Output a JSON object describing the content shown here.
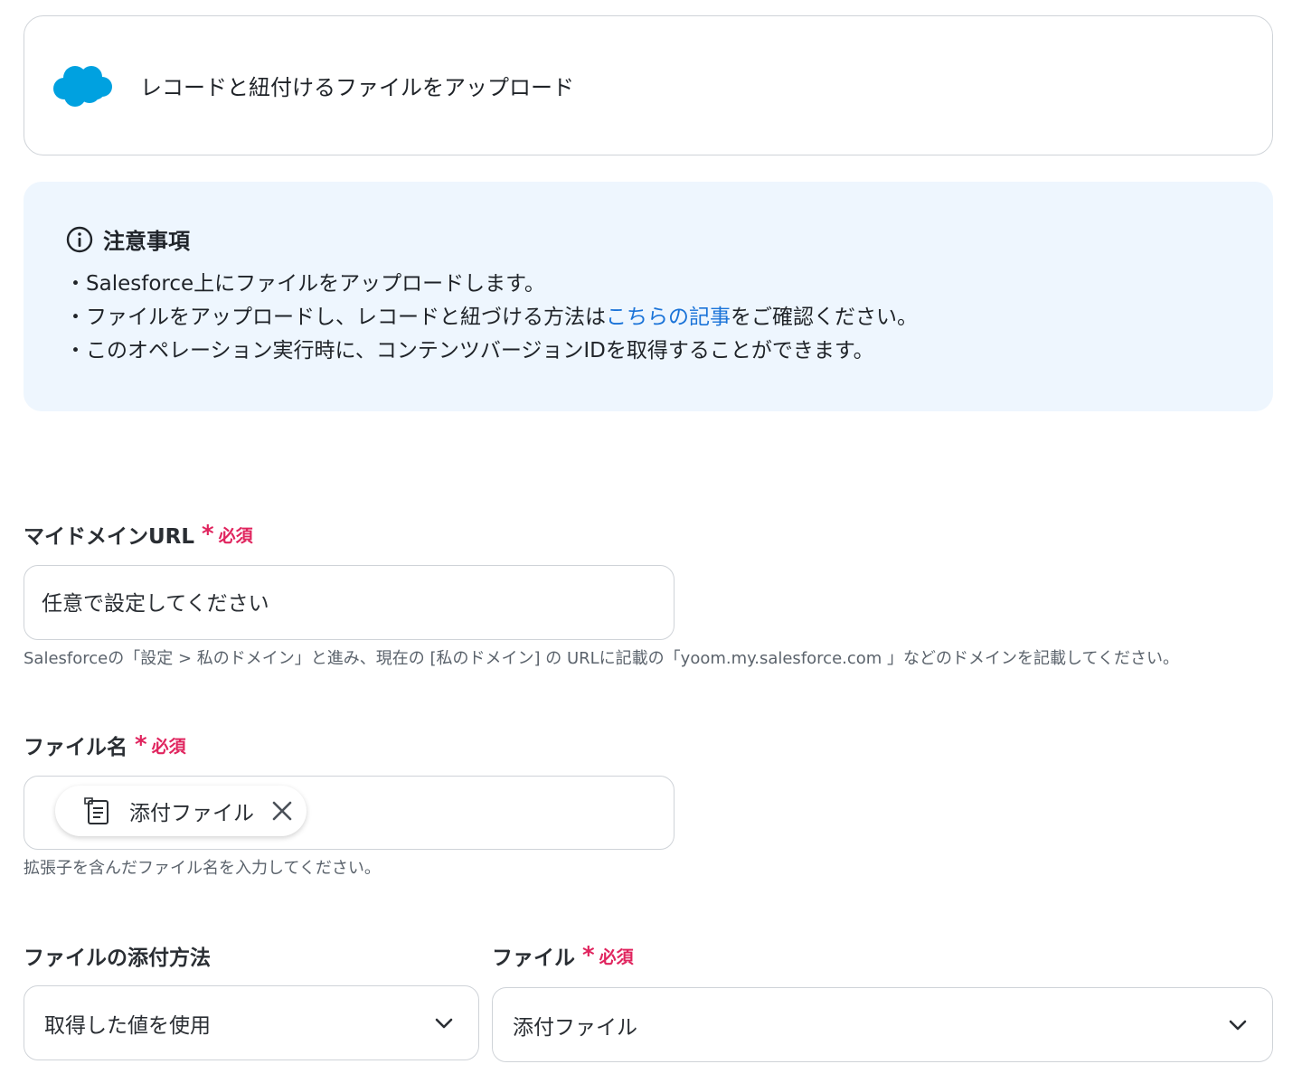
{
  "operation": {
    "logo": "salesforce-cloud-icon",
    "title": "レコードと紐付けるファイルをアップロード",
    "brand_color": "#00a1e0"
  },
  "notice": {
    "icon": "info-icon",
    "heading": "注意事項",
    "line1": "・Salesforce上にファイルをアップロードします。",
    "line2_before": "・ファイルをアップロードし、レコードと紐づける方法は",
    "line2_link": "こちらの記事",
    "line2_after": "をご確認ください。",
    "line3": "・このオペレーション実行時に、コンテンツバージョンIDを取得することができます。",
    "background": "#eef6fe",
    "link_color": "#1a73d8"
  },
  "required": {
    "star": "*",
    "text": "必須",
    "color": "#e0245e"
  },
  "domain_field": {
    "label": "マイドメインURL",
    "placeholder": "任意で設定してください",
    "help": "Salesforceの「設定 > 私のドメイン」と進み、現在の [私のドメイン] の URLに記載の「yoom.my.salesforce.com 」などのドメインを記載してください。"
  },
  "filename_field": {
    "label": "ファイル名",
    "chip_icon": "document-icon",
    "chip_text": "添付ファイル",
    "chip_close_icon": "close-icon",
    "help": "拡張子を含んだファイル名を入力してください。"
  },
  "attach_method_field": {
    "label": "ファイルの添付方法",
    "value": "取得した値を使用",
    "icon": "chevron-down-icon"
  },
  "file_field": {
    "label": "ファイル",
    "value": "添付ファイル",
    "icon": "chevron-down-icon"
  }
}
